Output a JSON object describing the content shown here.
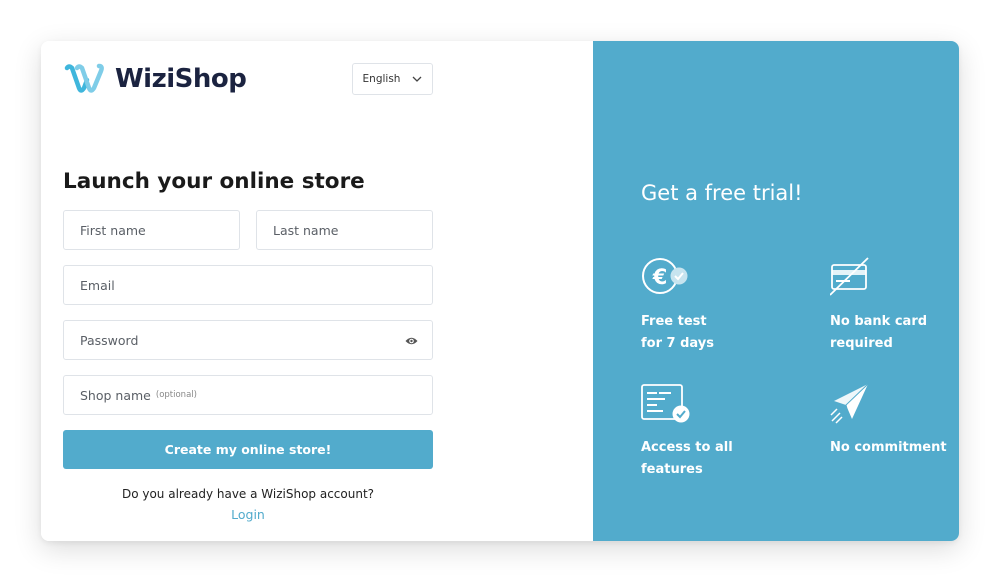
{
  "brand": {
    "name": "WiziShop",
    "accent_color": "#52abcc",
    "logo_icon": "wizishop-w-logo"
  },
  "language": {
    "selected": "English"
  },
  "form": {
    "title": "Launch your online store",
    "first_name_placeholder": "First name",
    "last_name_placeholder": "Last name",
    "email_placeholder": "Email",
    "password_placeholder": "Password",
    "shop_name_label": "Shop name",
    "shop_name_optional": "(optional)",
    "submit_label": "Create my online store!",
    "already_text": "Do you already have a WiziShop account?",
    "login_label": "Login"
  },
  "trial": {
    "title": "Get a free trial!",
    "features": [
      {
        "icon": "euro-check-icon",
        "label_line1": "Free test",
        "label_line2": "for 7 days"
      },
      {
        "icon": "no-bank-card-icon",
        "label_line1": "No bank card",
        "label_line2": "required"
      },
      {
        "icon": "document-check-icon",
        "label_line1": "Access to all",
        "label_line2": "features"
      },
      {
        "icon": "paper-plane-icon",
        "label_line1": "No commitment",
        "label_line2": ""
      }
    ]
  }
}
